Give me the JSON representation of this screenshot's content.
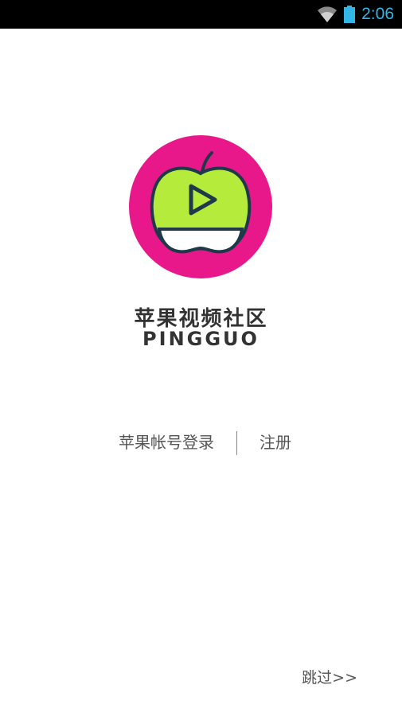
{
  "status_bar": {
    "time": "2:06",
    "icons": [
      "wifi-icon",
      "battery-icon"
    ],
    "accent_color": "#33b5e5"
  },
  "splash": {
    "title": "苹果视频社区",
    "subtitle": "PINGGUO",
    "logo_icon": "apple-play-logo",
    "colors": {
      "ring": "#e8188a",
      "apple": "#b5ec3c",
      "outline": "#1e3a4a"
    }
  },
  "auth": {
    "login_label": "苹果帐号登录",
    "register_label": "注册"
  },
  "skip_label": "跳过>>"
}
